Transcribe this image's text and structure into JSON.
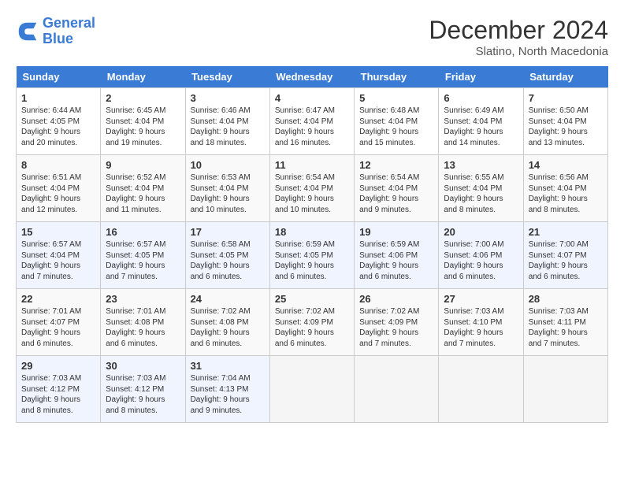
{
  "header": {
    "logo_line1": "General",
    "logo_line2": "Blue",
    "main_title": "December 2024",
    "subtitle": "Slatino, North Macedonia"
  },
  "days_of_week": [
    "Sunday",
    "Monday",
    "Tuesday",
    "Wednesday",
    "Thursday",
    "Friday",
    "Saturday"
  ],
  "weeks": [
    [
      {
        "day": "1",
        "sunrise": "6:44 AM",
        "sunset": "4:05 PM",
        "daylight": "9 hours and 20 minutes."
      },
      {
        "day": "2",
        "sunrise": "6:45 AM",
        "sunset": "4:04 PM",
        "daylight": "9 hours and 19 minutes."
      },
      {
        "day": "3",
        "sunrise": "6:46 AM",
        "sunset": "4:04 PM",
        "daylight": "9 hours and 18 minutes."
      },
      {
        "day": "4",
        "sunrise": "6:47 AM",
        "sunset": "4:04 PM",
        "daylight": "9 hours and 16 minutes."
      },
      {
        "day": "5",
        "sunrise": "6:48 AM",
        "sunset": "4:04 PM",
        "daylight": "9 hours and 15 minutes."
      },
      {
        "day": "6",
        "sunrise": "6:49 AM",
        "sunset": "4:04 PM",
        "daylight": "9 hours and 14 minutes."
      },
      {
        "day": "7",
        "sunrise": "6:50 AM",
        "sunset": "4:04 PM",
        "daylight": "9 hours and 13 minutes."
      }
    ],
    [
      {
        "day": "8",
        "sunrise": "6:51 AM",
        "sunset": "4:04 PM",
        "daylight": "9 hours and 12 minutes."
      },
      {
        "day": "9",
        "sunrise": "6:52 AM",
        "sunset": "4:04 PM",
        "daylight": "9 hours and 11 minutes."
      },
      {
        "day": "10",
        "sunrise": "6:53 AM",
        "sunset": "4:04 PM",
        "daylight": "9 hours and 10 minutes."
      },
      {
        "day": "11",
        "sunrise": "6:54 AM",
        "sunset": "4:04 PM",
        "daylight": "9 hours and 10 minutes."
      },
      {
        "day": "12",
        "sunrise": "6:54 AM",
        "sunset": "4:04 PM",
        "daylight": "9 hours and 9 minutes."
      },
      {
        "day": "13",
        "sunrise": "6:55 AM",
        "sunset": "4:04 PM",
        "daylight": "9 hours and 8 minutes."
      },
      {
        "day": "14",
        "sunrise": "6:56 AM",
        "sunset": "4:04 PM",
        "daylight": "9 hours and 8 minutes."
      }
    ],
    [
      {
        "day": "15",
        "sunrise": "6:57 AM",
        "sunset": "4:04 PM",
        "daylight": "9 hours and 7 minutes."
      },
      {
        "day": "16",
        "sunrise": "6:57 AM",
        "sunset": "4:05 PM",
        "daylight": "9 hours and 7 minutes."
      },
      {
        "day": "17",
        "sunrise": "6:58 AM",
        "sunset": "4:05 PM",
        "daylight": "9 hours and 6 minutes."
      },
      {
        "day": "18",
        "sunrise": "6:59 AM",
        "sunset": "4:05 PM",
        "daylight": "9 hours and 6 minutes."
      },
      {
        "day": "19",
        "sunrise": "6:59 AM",
        "sunset": "4:06 PM",
        "daylight": "9 hours and 6 minutes."
      },
      {
        "day": "20",
        "sunrise": "7:00 AM",
        "sunset": "4:06 PM",
        "daylight": "9 hours and 6 minutes."
      },
      {
        "day": "21",
        "sunrise": "7:00 AM",
        "sunset": "4:07 PM",
        "daylight": "9 hours and 6 minutes."
      }
    ],
    [
      {
        "day": "22",
        "sunrise": "7:01 AM",
        "sunset": "4:07 PM",
        "daylight": "9 hours and 6 minutes."
      },
      {
        "day": "23",
        "sunrise": "7:01 AM",
        "sunset": "4:08 PM",
        "daylight": "9 hours and 6 minutes."
      },
      {
        "day": "24",
        "sunrise": "7:02 AM",
        "sunset": "4:08 PM",
        "daylight": "9 hours and 6 minutes."
      },
      {
        "day": "25",
        "sunrise": "7:02 AM",
        "sunset": "4:09 PM",
        "daylight": "9 hours and 6 minutes."
      },
      {
        "day": "26",
        "sunrise": "7:02 AM",
        "sunset": "4:09 PM",
        "daylight": "9 hours and 7 minutes."
      },
      {
        "day": "27",
        "sunrise": "7:03 AM",
        "sunset": "4:10 PM",
        "daylight": "9 hours and 7 minutes."
      },
      {
        "day": "28",
        "sunrise": "7:03 AM",
        "sunset": "4:11 PM",
        "daylight": "9 hours and 7 minutes."
      }
    ],
    [
      {
        "day": "29",
        "sunrise": "7:03 AM",
        "sunset": "4:12 PM",
        "daylight": "9 hours and 8 minutes."
      },
      {
        "day": "30",
        "sunrise": "7:03 AM",
        "sunset": "4:12 PM",
        "daylight": "9 hours and 8 minutes."
      },
      {
        "day": "31",
        "sunrise": "7:04 AM",
        "sunset": "4:13 PM",
        "daylight": "9 hours and 9 minutes."
      },
      null,
      null,
      null,
      null
    ]
  ]
}
